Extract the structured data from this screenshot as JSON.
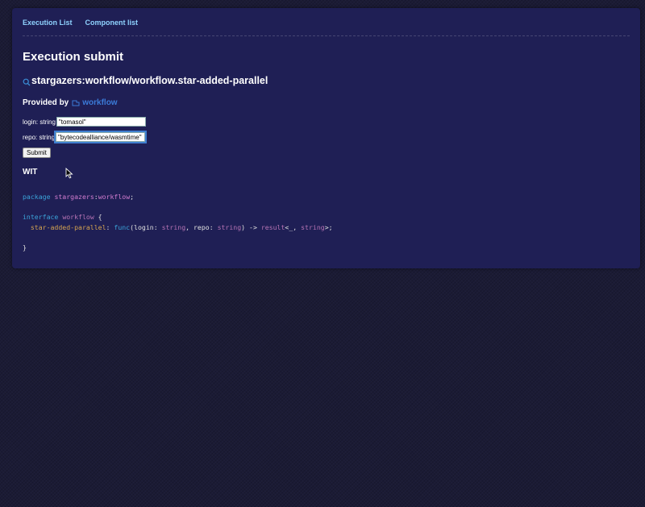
{
  "nav": {
    "items": [
      "Execution List",
      "Component list"
    ]
  },
  "page": {
    "title": "Execution submit",
    "ffqn": "stargazers:workflow/workflow.star-added-parallel",
    "provided_by_label": "Provided by",
    "component_name": "workflow"
  },
  "form": {
    "login_label": "login: string",
    "login_value": "\"tomasol\"",
    "repo_label": "repo: string",
    "repo_value": "\"bytecodealliance/wasmtime\"",
    "submit_label": "Submit"
  },
  "wit": {
    "title": "WIT",
    "line1_kw": "package",
    "line1_pkg": "stargazers",
    "line1_colon": ":",
    "line1_rest": "workflow",
    "line1_end": ";",
    "line2_kw": "interface",
    "line2_name": "workflow",
    "line2_brace": " {",
    "line3_fn_name": "star-added-parallel",
    "line3_colon": ": ",
    "line3_func": "func",
    "line3_params_open": "(",
    "line3_p1": "login",
    "line3_p1_sep": ": ",
    "line3_p1_ty": "string",
    "line3_comma": ", ",
    "line3_p2": "repo",
    "line3_p2_sep": ": ",
    "line3_p2_ty": "string",
    "line3_params_close": ") -> ",
    "line3_result": "result",
    "line3_result_args": "<_, ",
    "line3_result_ty": "string",
    "line3_end": ">;",
    "line4_close": "}"
  },
  "icons": {
    "search": "search-icon",
    "component": "component-icon",
    "cursor": "mouse-pointer-icon"
  },
  "colors": {
    "background": "#1b1b35",
    "card": "#1f1f55",
    "link": "#8fd3ff",
    "component_link": "#3b7bd8"
  }
}
